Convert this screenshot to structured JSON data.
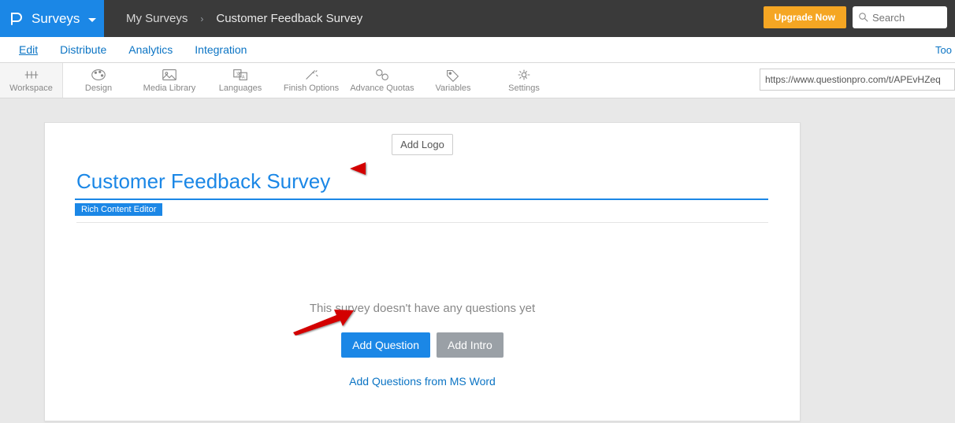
{
  "brand": {
    "label": "Surveys"
  },
  "breadcrumb": {
    "root": "My Surveys",
    "current": "Customer Feedback Survey"
  },
  "top_actions": {
    "upgrade": "Upgrade Now",
    "search_placeholder": "Search"
  },
  "tabs": {
    "edit": "Edit",
    "distribute": "Distribute",
    "analytics": "Analytics",
    "integration": "Integration",
    "right_cut": "Too"
  },
  "toolbar": {
    "workspace": "Workspace",
    "design": "Design",
    "media_library": "Media Library",
    "languages": "Languages",
    "finish_options": "Finish Options",
    "advance_quotas": "Advance Quotas",
    "variables": "Variables",
    "settings": "Settings",
    "url": "https://www.questionpro.com/t/APEvHZeq"
  },
  "survey": {
    "add_logo": "Add Logo",
    "title": "Customer Feedback Survey",
    "rich_editor_label": "Rich Content Editor",
    "empty_message": "This survey doesn't have any questions yet",
    "add_question": "Add Question",
    "add_intro": "Add Intro",
    "msword_link": "Add Questions from MS Word"
  }
}
